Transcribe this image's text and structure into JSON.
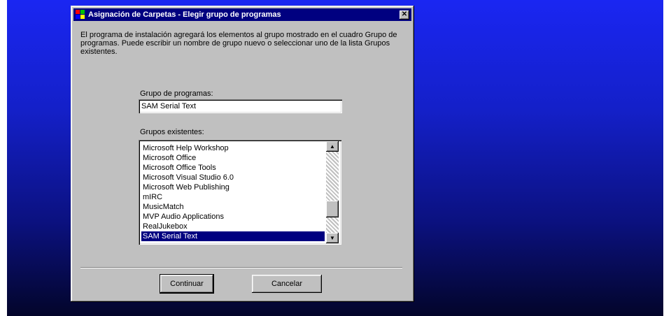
{
  "window": {
    "title": "Asignación de Carpetas - Elegir grupo de programas",
    "close_label": "✕"
  },
  "description": "El programa de instalación agregará los elementos al grupo mostrado en el cuadro Grupo de programas. Puede escribir un nombre de grupo nuevo o seleccionar uno de la lista Grupos existentes.",
  "program_group": {
    "label": "Grupo de programas:",
    "value": "SAM Serial Text"
  },
  "existing_groups": {
    "label": "Grupos existentes:",
    "items": [
      "Microsoft Help Workshop",
      "Microsoft Office",
      "Microsoft Office Tools",
      "Microsoft Visual Studio 6.0",
      "Microsoft Web Publishing",
      "mIRC",
      "MusicMatch",
      "MVP Audio Applications",
      "RealJukebox",
      "SAM Serial Text"
    ],
    "selected_index": 9
  },
  "buttons": {
    "continue_label": "Continuar",
    "cancel_label": "Cancelar"
  },
  "colors": {
    "titlebar": "#000080",
    "dialog_face": "#c0c0c0",
    "selection": "#000080",
    "desktop_top": "#1a26f2",
    "desktop_bottom": "#03052a"
  }
}
